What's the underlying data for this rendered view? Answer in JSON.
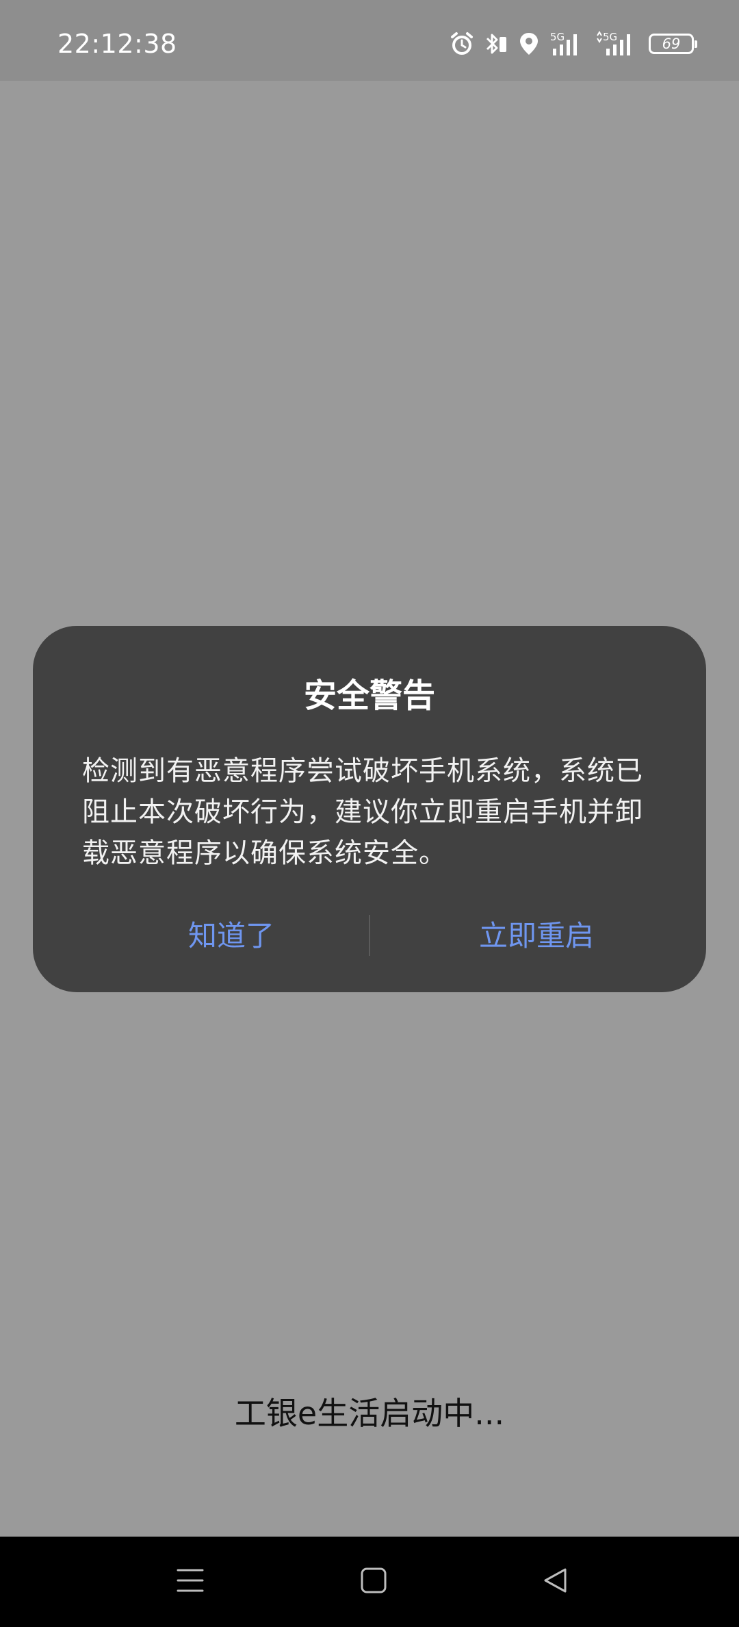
{
  "status_bar": {
    "time": "22:12:38",
    "network_1": "5G",
    "network_2": "5G",
    "battery": "69",
    "icons": [
      "alarm-icon",
      "bluetooth-icon",
      "location-icon",
      "signal-5g-icon",
      "signal-5g-data-icon",
      "battery-icon"
    ]
  },
  "dialog": {
    "title": "安全警告",
    "message": "检测到有恶意程序尝试破坏手机系统，系统已阻止本次破坏行为，建议你立即重启手机并卸载恶意程序以确保系统安全。",
    "dismiss_label": "知道了",
    "restart_label": "立即重启",
    "button_color": "#6f96f0"
  },
  "loading": {
    "text": "工银e生活启动中..."
  },
  "nav_bar": {
    "icons": [
      "menu-icon",
      "home-icon",
      "back-icon"
    ]
  }
}
